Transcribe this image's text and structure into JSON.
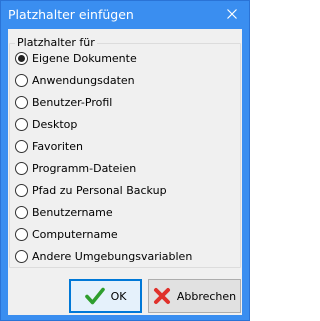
{
  "window": {
    "title": "Platzhalter einfügen",
    "close_icon": "close-icon"
  },
  "group": {
    "label": "Platzhalter für",
    "selected_index": 0,
    "options": [
      {
        "label": "Eigene Dokumente",
        "checked": true
      },
      {
        "label": "Anwendungsdaten",
        "checked": false
      },
      {
        "label": "Benutzer-Profil",
        "checked": false
      },
      {
        "label": "Desktop",
        "checked": false
      },
      {
        "label": "Favoriten",
        "checked": false
      },
      {
        "label": "Programm-Dateien",
        "checked": false
      },
      {
        "label": "Pfad zu Personal Backup",
        "checked": false
      },
      {
        "label": "Benutzername",
        "checked": false
      },
      {
        "label": "Computername",
        "checked": false
      },
      {
        "label": "Andere Umgebungsvariablen",
        "checked": false
      }
    ]
  },
  "buttons": {
    "ok": {
      "label": "OK",
      "icon": "checkmark-icon"
    },
    "cancel": {
      "label": "Abbrechen",
      "icon": "red-x-icon"
    }
  },
  "colors": {
    "titlebar": "#3a8ef0",
    "checkmark": "#2e9e2e",
    "cancel_x": "#e0312b"
  }
}
